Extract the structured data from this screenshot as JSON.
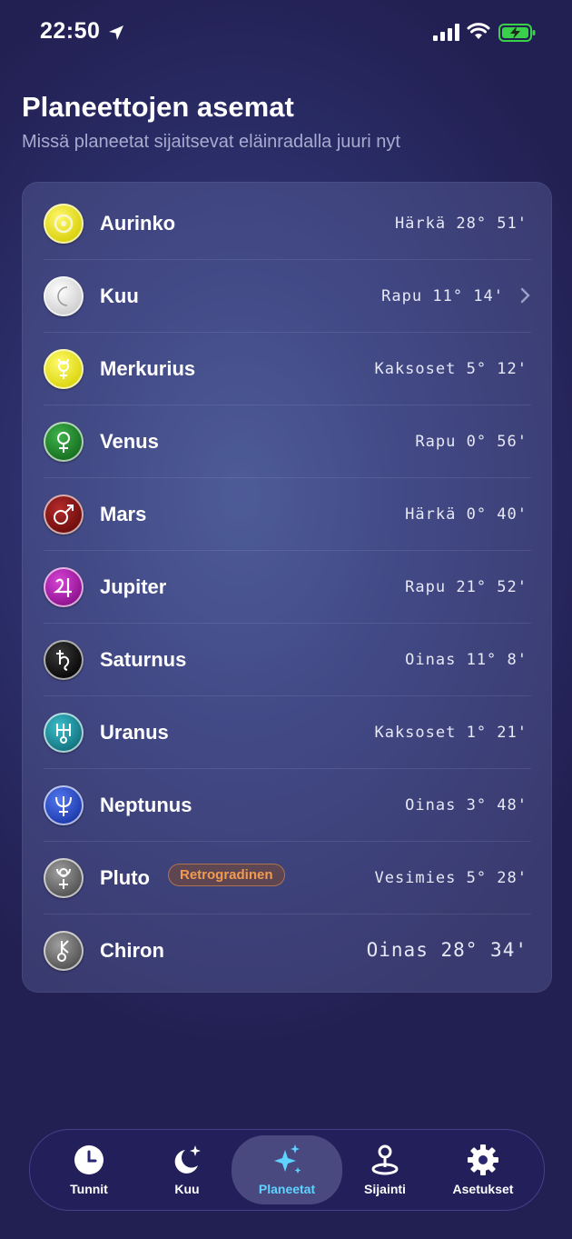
{
  "status_bar": {
    "time": "22:50"
  },
  "header": {
    "title": "Planeettojen asemat",
    "subtitle": "Missä planeetat sijaitsevat eläinradalla juuri nyt"
  },
  "planets": [
    {
      "name": "Aurinko",
      "position": "Härkä 28° 51'",
      "icon": "sun-icon",
      "color": "#e8e11a"
    },
    {
      "name": "Kuu",
      "position": "Rapu 11° 14'",
      "icon": "moon-icon",
      "color": "#f2f2f2"
    },
    {
      "name": "Merkurius",
      "position": "Kaksoset 5° 12'",
      "icon": "mercury-icon",
      "color": "#e6e21c"
    },
    {
      "name": "Venus",
      "position": "Rapu 0° 56'",
      "icon": "venus-icon",
      "color": "#1f8a2c"
    },
    {
      "name": "Mars",
      "position": "Härkä 0° 40'",
      "icon": "mars-icon",
      "color": "#8e1414"
    },
    {
      "name": "Jupiter",
      "position": "Rapu 21° 52'",
      "icon": "jupiter-icon",
      "color": "#b51cb5"
    },
    {
      "name": "Saturnus",
      "position": "Oinas 11° 8'",
      "icon": "saturn-icon",
      "color": "#121212"
    },
    {
      "name": "Uranus",
      "position": "Kaksoset 1° 21'",
      "icon": "uranus-icon",
      "color": "#1c9aa8"
    },
    {
      "name": "Neptunus",
      "position": "Oinas 3° 48'",
      "icon": "neptune-icon",
      "color": "#2b4fd4"
    },
    {
      "name": "Pluto",
      "position": "Vesimies 5° 28'",
      "icon": "pluto-icon",
      "color": "#7a7a7a",
      "badge": "Retrogradinen"
    },
    {
      "name": "Chiron",
      "position": "Oinas 28° 34'",
      "icon": "chiron-icon",
      "color": "#7a7a7a"
    }
  ],
  "tabs": [
    {
      "label": "Tunnit",
      "icon": "clock-icon"
    },
    {
      "label": "Kuu",
      "icon": "moon-stars-icon"
    },
    {
      "label": "Planeetat",
      "icon": "sparkles-icon",
      "active": true
    },
    {
      "label": "Sijainti",
      "icon": "location-pin-icon"
    },
    {
      "label": "Asetukset",
      "icon": "gear-icon"
    }
  ],
  "colors": {
    "accent": "#5fd3ff",
    "badge": "#f39a4e",
    "battery": "#3ad14a"
  }
}
